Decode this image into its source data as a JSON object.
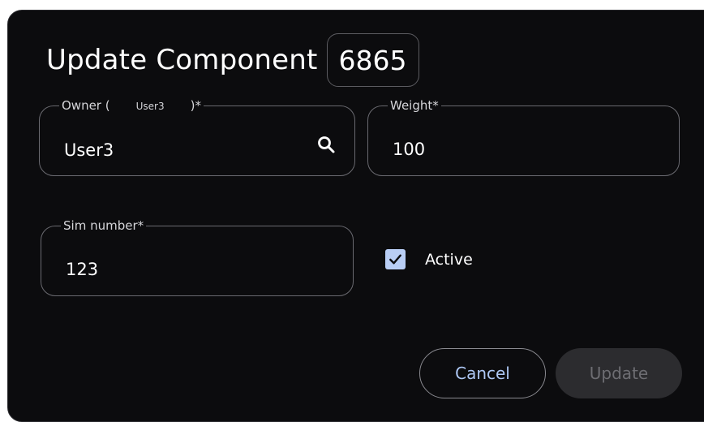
{
  "dialog": {
    "title": "Update Component",
    "id": "6865"
  },
  "fields": {
    "owner": {
      "label_prefix": "Owner (",
      "label_user": "User3",
      "label_suffix": ")*",
      "value": "User3",
      "icon": "search-icon"
    },
    "weight": {
      "label": "Weight*",
      "value": "100"
    },
    "sim_number": {
      "label": "Sim number*",
      "value": "123"
    }
  },
  "active": {
    "label": "Active",
    "checked": true
  },
  "buttons": {
    "cancel": "Cancel",
    "update": "Update"
  },
  "colors": {
    "background": "#0c0c0e",
    "accent": "#aec8f5",
    "checkbox": "#b9cef5",
    "disabled_button": "#2c2c2f"
  }
}
